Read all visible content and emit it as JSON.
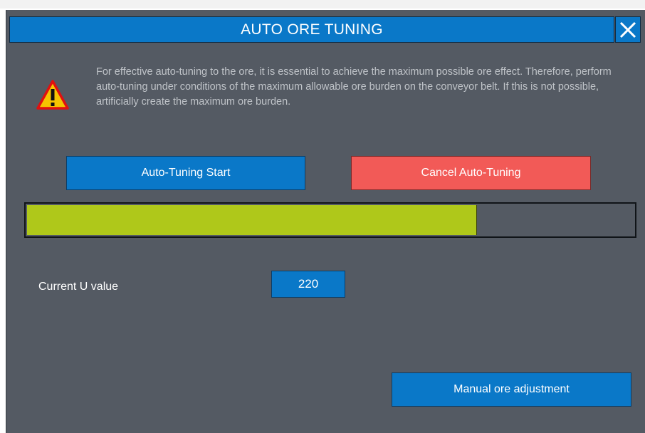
{
  "dialog": {
    "title": "AUTO ORE TUNING",
    "close_icon": "close-icon",
    "warning_icon": "warning-icon",
    "notice_text": "For effective auto-tuning to the ore, it is essential to achieve the maximum possible ore effect. Therefore, perform auto-tuning under conditions of the maximum allowable ore burden on the conveyor belt. If this is not possible, artificially create the maximum ore burden.",
    "buttons": {
      "start_label": "Auto-Tuning Start",
      "cancel_label": "Cancel Auto-Tuning",
      "manual_label": "Manual ore adjustment"
    },
    "progress": {
      "fraction": 0.74,
      "fill_color": "#afc81a"
    },
    "current_u": {
      "label": "Current U value",
      "value": "220"
    },
    "colors": {
      "accent_blue": "#0a78c8",
      "cancel_red": "#f25a57",
      "panel_bg": "#545a63"
    }
  }
}
